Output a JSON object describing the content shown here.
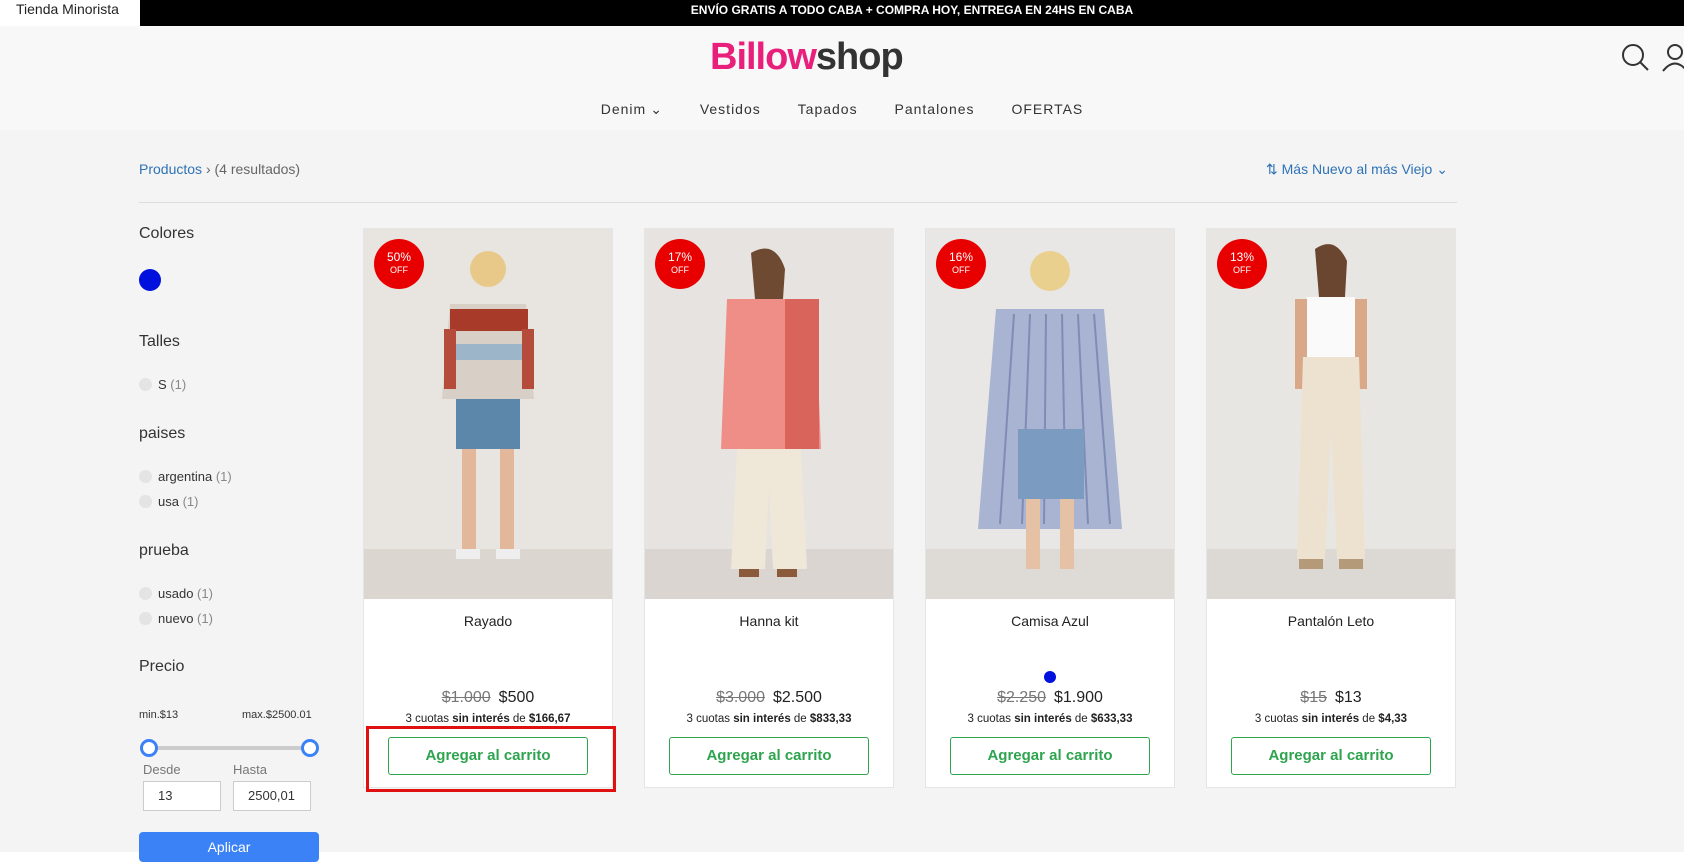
{
  "topbar": {
    "store_tab": "Tienda Minorista",
    "promo": "ENVÍO GRATIS A TODO CABA + COMPRA HOY, ENTREGA EN 24HS EN CABA"
  },
  "header": {
    "logo_part1": "Billow",
    "logo_part2": "shop",
    "nav": [
      "Denim",
      "Vestidos",
      "Tapados",
      "Pantalones",
      "OFERTAS"
    ]
  },
  "breadcrumb": {
    "link": "Productos",
    "separator": "›",
    "results": "(4 resultados)"
  },
  "sort": {
    "label": "Más Nuevo al más Viejo"
  },
  "filters": {
    "colores_title": "Colores",
    "talles_title": "Talles",
    "talles": [
      {
        "label": "S",
        "count": "(1)"
      }
    ],
    "paises_title": "paises",
    "paises": [
      {
        "label": "argentina",
        "count": "(1)"
      },
      {
        "label": "usa",
        "count": "(1)"
      }
    ],
    "prueba_title": "prueba",
    "prueba": [
      {
        "label": "usado",
        "count": "(1)"
      },
      {
        "label": "nuevo",
        "count": "(1)"
      }
    ],
    "precio_title": "Precio",
    "min_label": "min.$13",
    "max_label": "max.$2500.01",
    "desde_label": "Desde",
    "hasta_label": "Hasta",
    "desde_value": "13",
    "hasta_value": "2500,01",
    "apply": "Aplicar"
  },
  "products": [
    {
      "discount": "50%",
      "off": "OFF",
      "name": "Rayado",
      "old_price": "$1.000",
      "price": "$500",
      "cuotas_pre": "3 cuotas ",
      "cuotas_bold": "sin interés",
      "cuotas_mid": " de ",
      "cuotas_amount": "$166,67",
      "button": "Agregar al carrito"
    },
    {
      "discount": "17%",
      "off": "OFF",
      "name": "Hanna kit",
      "old_price": "$3.000",
      "price": "$2.500",
      "cuotas_pre": "3 cuotas ",
      "cuotas_bold": "sin interés",
      "cuotas_mid": " de ",
      "cuotas_amount": "$833,33",
      "button": "Agregar al carrito"
    },
    {
      "discount": "16%",
      "off": "OFF",
      "name": "Camisa Azul",
      "old_price": "$2.250",
      "price": "$1.900",
      "cuotas_pre": "3 cuotas ",
      "cuotas_bold": "sin interés",
      "cuotas_mid": " de ",
      "cuotas_amount": "$633,33",
      "button": "Agregar al carrito"
    },
    {
      "discount": "13%",
      "off": "OFF",
      "name": "Pantalón Leto",
      "old_price": "$15",
      "price": "$13",
      "cuotas_pre": "3 cuotas ",
      "cuotas_bold": "sin interés",
      "cuotas_mid": " de ",
      "cuotas_amount": "$4,33",
      "button": "Agregar al carrito"
    }
  ],
  "colors": {
    "accent_green": "#2ea44f",
    "badge_red": "#e80000",
    "link_blue": "#2e72b6",
    "swatch_blue": "#0011dd"
  }
}
